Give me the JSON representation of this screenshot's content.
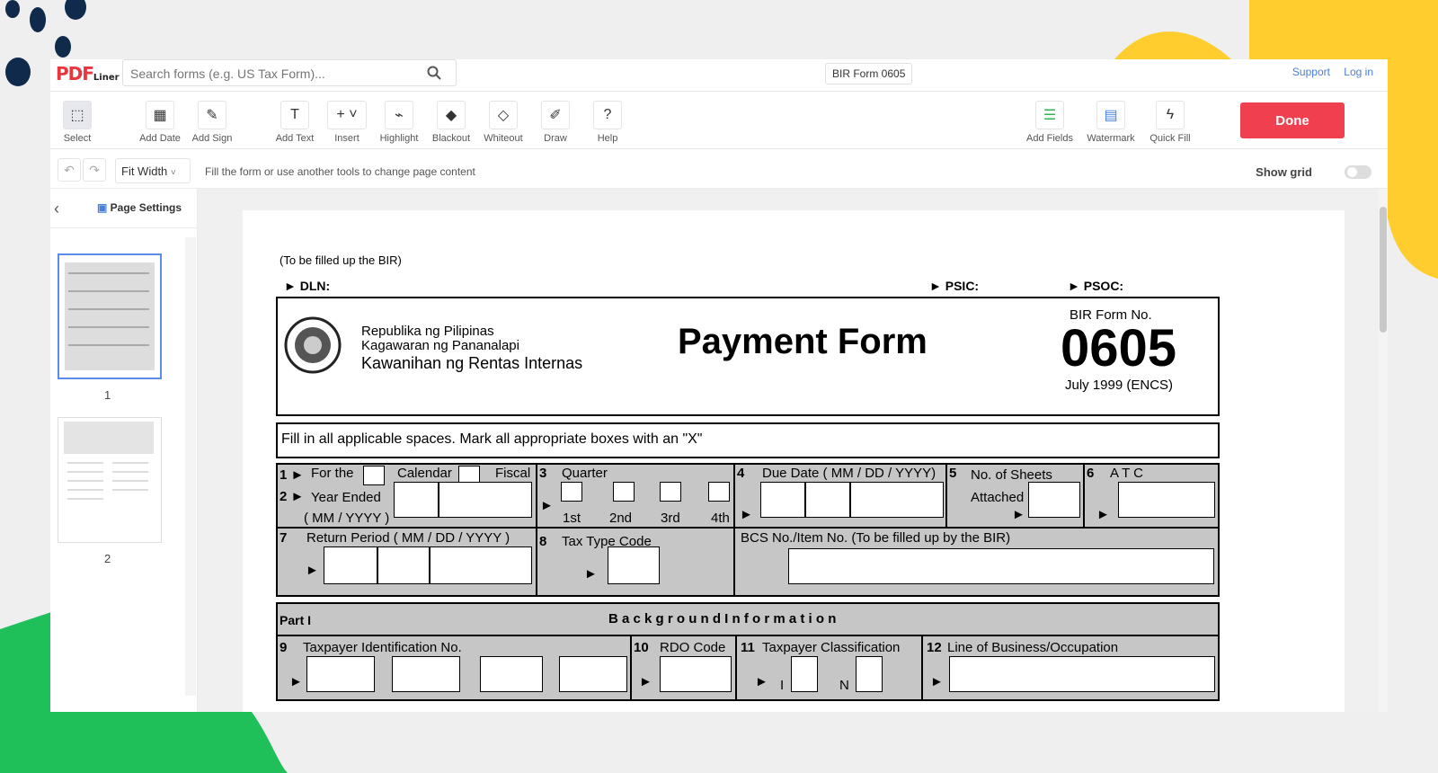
{
  "app": {
    "logo": "PDF",
    "logo_sub": "Liner",
    "search_placeholder": "Search forms (e.g. US Tax Form)...",
    "doc_title": "BIR Form 0605",
    "support": "Support",
    "login": "Log in"
  },
  "toolbar": {
    "select": "Select",
    "add_date": "Add Date",
    "add_sign": "Add Sign",
    "add_text": "Add Text",
    "insert": "Insert",
    "highlight": "Highlight",
    "blackout": "Blackout",
    "whiteout": "Whiteout",
    "draw": "Draw",
    "help": "Help",
    "add_fields": "Add Fields",
    "watermark": "Watermark",
    "quick_fill": "Quick Fill",
    "done": "Done"
  },
  "subbar": {
    "zoom": "Fit Width",
    "hint": "Fill the form or use another tools to change page content",
    "show_grid": "Show grid"
  },
  "sidebar": {
    "page_settings": "Page Settings",
    "pages": [
      "1",
      "2"
    ]
  },
  "form": {
    "to_be_filled": "(To be filled up the BIR)",
    "dln": "DLN:",
    "psic": "PSIC:",
    "psoc": "PSOC:",
    "agency1": "Republika ng Pilipinas",
    "agency2": "Kagawaran ng Pananalapi",
    "agency3": "Kawanihan ng Rentas Internas",
    "title": "Payment Form",
    "form_no_label": "BIR Form No.",
    "form_no": "0605",
    "version": "July 1999 (ENCS)",
    "instructions": "Fill in all applicable spaces.  Mark all appropriate boxes with an \"X\"",
    "f1": "For the",
    "calendar": "Calendar",
    "fiscal": "Fiscal",
    "f2": "Year Ended",
    "mmyyyy": "( MM / YYYY )",
    "f3": "Quarter",
    "q1": "1st",
    "q2": "2nd",
    "q3": "3rd",
    "q4": "4th",
    "f4": "Due Date ( MM / DD / YYYY)",
    "f5a": "No. of Sheets",
    "f5b": "Attached",
    "f6": "A T C",
    "f7": "Return Period ( MM / DD / YYYY )",
    "f8": "Tax Type Code",
    "bcs": "BCS No./Item No. (To be filled up by the  BIR)",
    "part1": "Part I",
    "part1_title": "B a c k g r o u n d   I n f o r m a t i o n",
    "f9": "Taxpayer Identification  No.",
    "f10": "RDO Code",
    "f11": "Taxpayer Classification",
    "f12": "Line of Business/Occupation",
    "n1": "1",
    "n2": "2",
    "n3": "3",
    "n4": "4",
    "n5": "5",
    "n6": "6",
    "n7": "7",
    "n8": "8",
    "n9": "9",
    "n10": "10",
    "n11": "11",
    "n12": "12",
    "class_i": "I",
    "class_n": "N"
  }
}
